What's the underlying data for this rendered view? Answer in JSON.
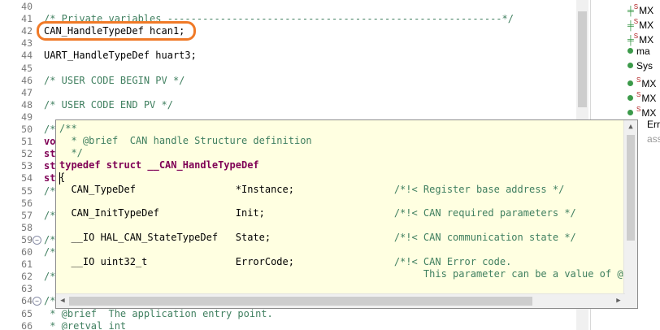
{
  "editor": {
    "lines": [
      {
        "n": "40",
        "text": "",
        "cls": ""
      },
      {
        "n": "41",
        "text": "/* Private variables ---------------------------------------------------------*/",
        "cls": "cmt"
      },
      {
        "n": "42",
        "text": "CAN_HandleTypeDef hcan1;",
        "cls": ""
      },
      {
        "n": "43",
        "text": "",
        "cls": ""
      },
      {
        "n": "44",
        "text": "UART_HandleTypeDef huart3;",
        "cls": ""
      },
      {
        "n": "45",
        "text": "",
        "cls": ""
      },
      {
        "n": "46",
        "text": "/* USER CODE BEGIN PV */",
        "cls": "cmt"
      },
      {
        "n": "47",
        "text": "",
        "cls": ""
      },
      {
        "n": "48",
        "text": "/* USER CODE END PV */",
        "cls": "cmt"
      },
      {
        "n": "49",
        "text": "",
        "cls": ""
      },
      {
        "n": "50",
        "text": "/*",
        "cls": "cmt"
      },
      {
        "n": "51",
        "text": "vo",
        "cls": "kw"
      },
      {
        "n": "52",
        "text": "st",
        "cls": "kw"
      },
      {
        "n": "53",
        "text": "st",
        "cls": "kw"
      },
      {
        "n": "54",
        "text": "st",
        "cls": "kw"
      },
      {
        "n": "55",
        "text": "/*",
        "cls": "cmt"
      },
      {
        "n": "56",
        "text": "",
        "cls": ""
      },
      {
        "n": "57",
        "text": "/*",
        "cls": "cmt"
      },
      {
        "n": "58",
        "text": "",
        "cls": ""
      },
      {
        "n": "59",
        "text": "/*",
        "cls": "cmt"
      },
      {
        "n": "60",
        "text": "/*",
        "cls": "cmt"
      },
      {
        "n": "61",
        "text": "",
        "cls": ""
      },
      {
        "n": "62",
        "text": "/*",
        "cls": "cmt"
      },
      {
        "n": "63",
        "text": "",
        "cls": ""
      },
      {
        "n": "64",
        "text": "/*",
        "cls": "cmt"
      },
      {
        "n": "65",
        "text": " * @brief  The application entry point.",
        "cls": "cmt"
      },
      {
        "n": "66",
        "text": " * @retval int",
        "cls": "cmt"
      }
    ]
  },
  "popup": {
    "lines": [
      {
        "text": "/**",
        "cls": "cmt"
      },
      {
        "text": "  * @brief  CAN handle Structure definition",
        "cls": "cmt"
      },
      {
        "text": "  */",
        "cls": "cmt"
      },
      {
        "text": "typedef struct __CAN_HandleTypeDef",
        "cls": "kw"
      },
      {
        "text": "{",
        "cls": ""
      },
      {
        "text": "  CAN_TypeDef                 *Instance;                 /*!< Register base address */",
        "cls": "mix"
      },
      {
        "text": "",
        "cls": ""
      },
      {
        "text": "  CAN_InitTypeDef             Init;                      /*!< CAN required parameters */",
        "cls": "mix"
      },
      {
        "text": "",
        "cls": ""
      },
      {
        "text": "  __IO HAL_CAN_StateTypeDef   State;                     /*!< CAN communication state */",
        "cls": "mix"
      },
      {
        "text": "",
        "cls": ""
      },
      {
        "text": "  __IO uint32_t               ErrorCode;                 /*!< CAN Error code.",
        "cls": "mix"
      },
      {
        "text": "                                                              This parameter can be a value of @ref",
        "cls": "cmt"
      }
    ]
  },
  "outline": {
    "items": [
      {
        "kind": "hash",
        "text": "MX"
      },
      {
        "kind": "hash",
        "text": "MX"
      },
      {
        "kind": "hash",
        "text": "MX"
      },
      {
        "kind": "dot",
        "text": "ma"
      },
      {
        "kind": "dot",
        "text": "Sys"
      },
      {
        "kind": "dotS",
        "text": "MX"
      },
      {
        "kind": "dotS",
        "text": "MX"
      },
      {
        "kind": "dotS",
        "text": "MX"
      },
      {
        "kind": "plain",
        "text": "Err"
      },
      {
        "kind": "faint",
        "text": "ass"
      }
    ]
  }
}
